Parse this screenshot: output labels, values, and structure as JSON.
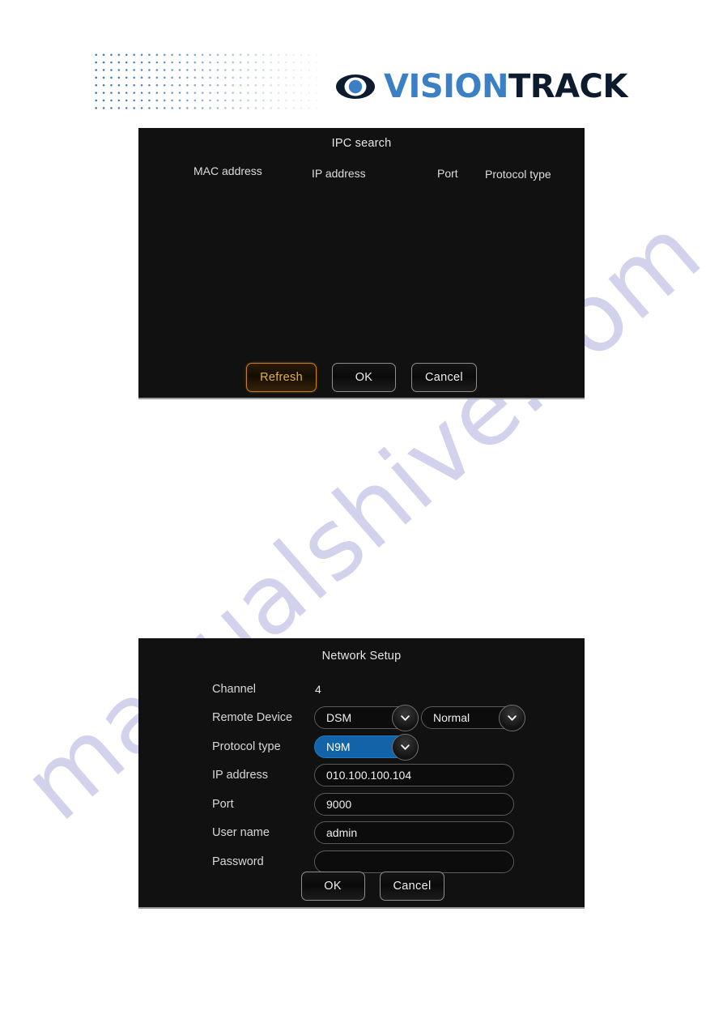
{
  "brand": {
    "name_part1": "VISION",
    "name_part2": "TRACK",
    "eye_icon": "eye-icon",
    "dot_pattern": "dot-grid-pattern",
    "blue": "#3b80c4",
    "navy": "#0d1b2e"
  },
  "watermark": {
    "text": "manualshive.com",
    "color": "#6c6ac4"
  },
  "ipc_search": {
    "title": "IPC search",
    "columns": [
      "MAC address",
      "IP address",
      "Port",
      "Protocol type"
    ],
    "rows": [],
    "buttons": [
      {
        "label": "Refresh",
        "focused": true
      },
      {
        "label": "OK",
        "focused": false
      },
      {
        "label": "Cancel",
        "focused": false
      }
    ]
  },
  "network_setup": {
    "title": "Network Setup",
    "rows": [
      {
        "label": "Channel",
        "type": "text",
        "value": "4"
      },
      {
        "label": "Remote Device",
        "type": "dual",
        "value": "DSM",
        "value2": "Normal"
      },
      {
        "label": "Protocol type",
        "type": "dropdown",
        "value": "N9M",
        "selected": true
      },
      {
        "label": "IP address",
        "type": "input",
        "value": "010.100.100.104"
      },
      {
        "label": "Port",
        "type": "input",
        "value": "9000"
      },
      {
        "label": "User name",
        "type": "input",
        "value": "admin"
      },
      {
        "label": "Password",
        "type": "input",
        "value": ""
      }
    ],
    "buttons": [
      {
        "label": "OK",
        "focused": false
      },
      {
        "label": "Cancel",
        "focused": false
      }
    ],
    "accent_selected": "#1363a8",
    "chevron_icon": "chevron-down-icon"
  }
}
